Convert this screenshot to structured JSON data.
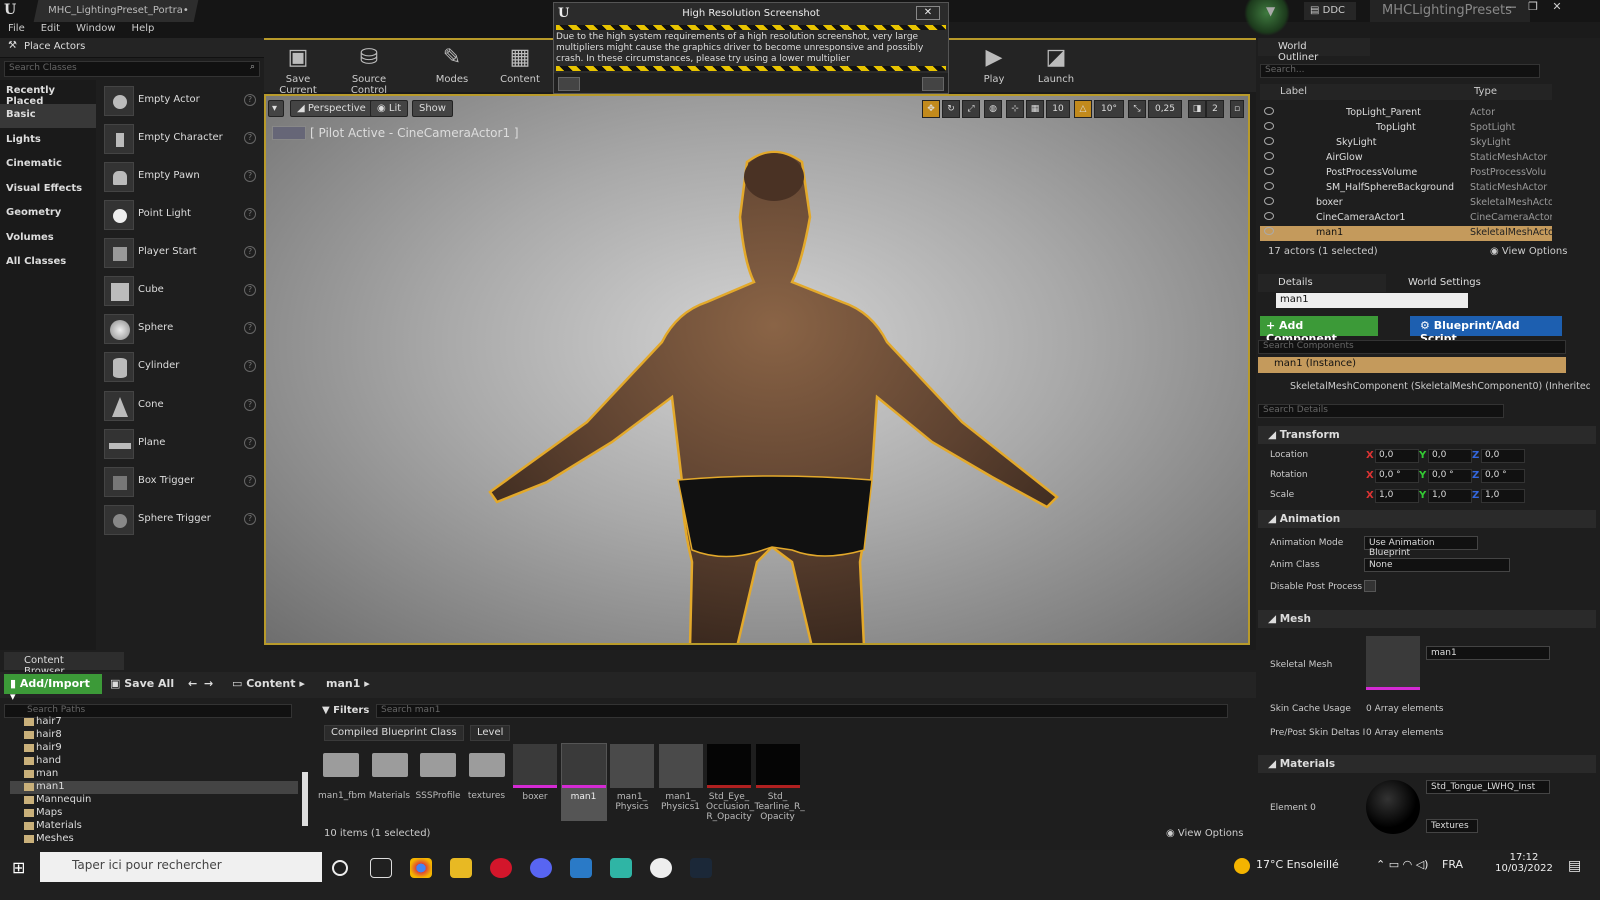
{
  "titlebar": {
    "doc_tab": "MHC_LightingPreset_Portra•",
    "ddc": "DDC",
    "project": "MHCLightingPresets",
    "min": "—",
    "max": "❐",
    "close": "✕"
  },
  "menu": [
    "File",
    "Edit",
    "Window",
    "Help"
  ],
  "place_actors": {
    "title": "Place Actors",
    "search_placeholder": "Search Classes",
    "categories": [
      "Recently Placed",
      "Basic",
      "Lights",
      "Cinematic",
      "Visual Effects",
      "Geometry",
      "Volumes",
      "All Classes"
    ],
    "items": [
      "Empty Actor",
      "Empty Character",
      "Empty Pawn",
      "Point Light",
      "Player Start",
      "Cube",
      "Sphere",
      "Cylinder",
      "Cone",
      "Plane",
      "Box Trigger",
      "Sphere Trigger"
    ]
  },
  "toolbar": {
    "save_current": "Save Current",
    "source_control": "Source Control",
    "modes": "Modes",
    "content": "Content",
    "play": "Play",
    "launch": "Launch"
  },
  "popup": {
    "title": "High Resolution Screenshot",
    "message": "Due to the high system requirements of a high resolution screenshot, very large multipliers might cause the graphics driver to become unresponsive and possibly crash. In these circumstances, please try using a lower multiplier"
  },
  "viewport": {
    "perspective": "Perspective",
    "lit": "Lit",
    "show": "Show",
    "pilot": "[ Pilot Active - CineCameraActor1 ]",
    "grid_snap": "10",
    "rot_snap": "10°",
    "scale_snap": "0,25",
    "cam_speed": "2"
  },
  "outliner": {
    "title": "World Outliner",
    "search_placeholder": "Search...",
    "col_label": "Label",
    "col_type": "Type",
    "rows": [
      {
        "label": "TopLight_Parent",
        "type": "Actor"
      },
      {
        "label": "TopLight",
        "type": "SpotLight"
      },
      {
        "label": "SkyLight",
        "type": "SkyLight"
      },
      {
        "label": "AirGlow",
        "type": "StaticMeshActor"
      },
      {
        "label": "PostProcessVolume",
        "type": "PostProcessVolu"
      },
      {
        "label": "SM_HalfSphereBackground",
        "type": "StaticMeshActor"
      },
      {
        "label": "boxer",
        "type": "SkeletalMeshActo"
      },
      {
        "label": "CineCameraActor1",
        "type": "CineCameraActor"
      },
      {
        "label": "man1",
        "type": "SkeletalMeshActo"
      }
    ],
    "count": "17 actors (1 selected)",
    "view_options": "View Options"
  },
  "details": {
    "tab_details": "Details",
    "tab_world": "World Settings",
    "name": "man1",
    "add_component": "+ Add Component",
    "blueprint": "Blueprint/Add Script",
    "search_components": "Search Components",
    "instance": "man1 (Instance)",
    "component": "SkeletalMeshComponent (SkeletalMeshComponent0) (Inherited)",
    "search_details": "Search Details",
    "transform": "Transform",
    "location": "Location",
    "rotation": "Rotation",
    "scale": "Scale",
    "loc": [
      "0,0",
      "0,0",
      "0,0"
    ],
    "rot": [
      "0,0 °",
      "0,0 °",
      "0,0 °"
    ],
    "scl": [
      "1,0",
      "1,0",
      "1,0"
    ],
    "animation": "Animation",
    "anim_mode": "Animation Mode",
    "anim_mode_val": "Use Animation Blueprint",
    "anim_class": "Anim Class",
    "anim_class_val": "None",
    "disable_pp": "Disable Post Process",
    "mesh": "Mesh",
    "skeletal_mesh": "Skeletal Mesh",
    "skeletal_mesh_val": "man1",
    "skin_cache": "Skin Cache Usage",
    "skin_cache_val": "0 Array elements",
    "prepost": "Pre/Post Skin Deltas I",
    "prepost_val": "0 Array elements",
    "materials": "Materials",
    "element0": "Element 0",
    "element0_val": "Std_Tongue_LWHQ_Inst",
    "textures": "Textures"
  },
  "content_browser": {
    "tab": "Content Browser",
    "add_import": "Add/Import",
    "save_all": "Save All",
    "crumb_root": "Content",
    "crumb_folder": "man1",
    "search_paths": "Search Paths",
    "tree": [
      "hair7",
      "hair8",
      "hair9",
      "hand",
      "man",
      "man1",
      "Mannequin",
      "Maps",
      "Materials",
      "Meshes"
    ],
    "filters": "Filters",
    "search_assets": "Search man1",
    "chips": [
      "Compiled Blueprint Class",
      "Level"
    ],
    "assets": [
      {
        "name": "man1_fbm",
        "kind": "folder"
      },
      {
        "name": "Materials",
        "kind": "folder"
      },
      {
        "name": "SSSProfile",
        "kind": "folder"
      },
      {
        "name": "textures",
        "kind": "folder"
      },
      {
        "name": "boxer",
        "kind": "mesh"
      },
      {
        "name": "man1",
        "kind": "mesh"
      },
      {
        "name": "man1_ Physics",
        "kind": "phys"
      },
      {
        "name": "man1_ Physics1",
        "kind": "phys"
      },
      {
        "name": "Std_Eye_ Occlusion_ R_Opacity",
        "kind": "tex"
      },
      {
        "name": "Std_ Tearline_R_ Opacity",
        "kind": "tex"
      }
    ],
    "count": "10 items (1 selected)",
    "view_options": "View Options"
  },
  "taskbar": {
    "search": "Taper ici pour rechercher",
    "weather": "17°C Ensoleillé",
    "lang": "FRA",
    "time": "17:12",
    "date": "10/03/2022"
  }
}
